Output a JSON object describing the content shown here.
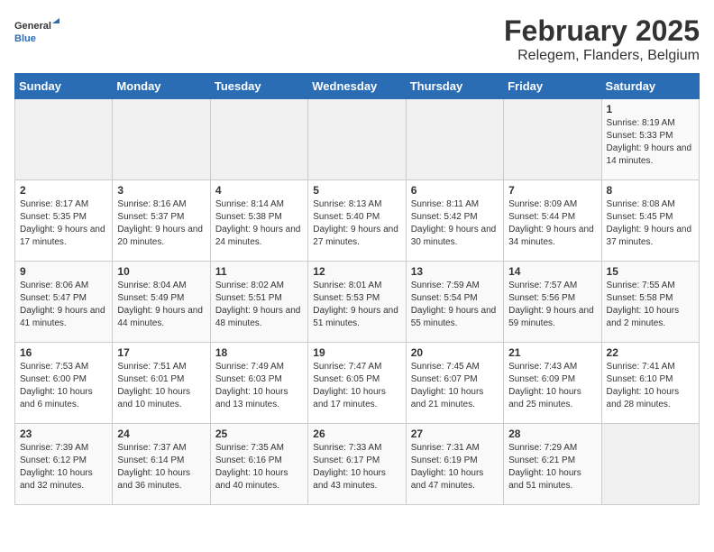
{
  "header": {
    "logo_general": "General",
    "logo_blue": "Blue",
    "main_title": "February 2025",
    "subtitle": "Relegem, Flanders, Belgium"
  },
  "days_of_week": [
    "Sunday",
    "Monday",
    "Tuesday",
    "Wednesday",
    "Thursday",
    "Friday",
    "Saturday"
  ],
  "weeks": [
    [
      {
        "day": "",
        "info": ""
      },
      {
        "day": "",
        "info": ""
      },
      {
        "day": "",
        "info": ""
      },
      {
        "day": "",
        "info": ""
      },
      {
        "day": "",
        "info": ""
      },
      {
        "day": "",
        "info": ""
      },
      {
        "day": "1",
        "info": "Sunrise: 8:19 AM\nSunset: 5:33 PM\nDaylight: 9 hours and 14 minutes."
      }
    ],
    [
      {
        "day": "2",
        "info": "Sunrise: 8:17 AM\nSunset: 5:35 PM\nDaylight: 9 hours and 17 minutes."
      },
      {
        "day": "3",
        "info": "Sunrise: 8:16 AM\nSunset: 5:37 PM\nDaylight: 9 hours and 20 minutes."
      },
      {
        "day": "4",
        "info": "Sunrise: 8:14 AM\nSunset: 5:38 PM\nDaylight: 9 hours and 24 minutes."
      },
      {
        "day": "5",
        "info": "Sunrise: 8:13 AM\nSunset: 5:40 PM\nDaylight: 9 hours and 27 minutes."
      },
      {
        "day": "6",
        "info": "Sunrise: 8:11 AM\nSunset: 5:42 PM\nDaylight: 9 hours and 30 minutes."
      },
      {
        "day": "7",
        "info": "Sunrise: 8:09 AM\nSunset: 5:44 PM\nDaylight: 9 hours and 34 minutes."
      },
      {
        "day": "8",
        "info": "Sunrise: 8:08 AM\nSunset: 5:45 PM\nDaylight: 9 hours and 37 minutes."
      }
    ],
    [
      {
        "day": "9",
        "info": "Sunrise: 8:06 AM\nSunset: 5:47 PM\nDaylight: 9 hours and 41 minutes."
      },
      {
        "day": "10",
        "info": "Sunrise: 8:04 AM\nSunset: 5:49 PM\nDaylight: 9 hours and 44 minutes."
      },
      {
        "day": "11",
        "info": "Sunrise: 8:02 AM\nSunset: 5:51 PM\nDaylight: 9 hours and 48 minutes."
      },
      {
        "day": "12",
        "info": "Sunrise: 8:01 AM\nSunset: 5:53 PM\nDaylight: 9 hours and 51 minutes."
      },
      {
        "day": "13",
        "info": "Sunrise: 7:59 AM\nSunset: 5:54 PM\nDaylight: 9 hours and 55 minutes."
      },
      {
        "day": "14",
        "info": "Sunrise: 7:57 AM\nSunset: 5:56 PM\nDaylight: 9 hours and 59 minutes."
      },
      {
        "day": "15",
        "info": "Sunrise: 7:55 AM\nSunset: 5:58 PM\nDaylight: 10 hours and 2 minutes."
      }
    ],
    [
      {
        "day": "16",
        "info": "Sunrise: 7:53 AM\nSunset: 6:00 PM\nDaylight: 10 hours and 6 minutes."
      },
      {
        "day": "17",
        "info": "Sunrise: 7:51 AM\nSunset: 6:01 PM\nDaylight: 10 hours and 10 minutes."
      },
      {
        "day": "18",
        "info": "Sunrise: 7:49 AM\nSunset: 6:03 PM\nDaylight: 10 hours and 13 minutes."
      },
      {
        "day": "19",
        "info": "Sunrise: 7:47 AM\nSunset: 6:05 PM\nDaylight: 10 hours and 17 minutes."
      },
      {
        "day": "20",
        "info": "Sunrise: 7:45 AM\nSunset: 6:07 PM\nDaylight: 10 hours and 21 minutes."
      },
      {
        "day": "21",
        "info": "Sunrise: 7:43 AM\nSunset: 6:09 PM\nDaylight: 10 hours and 25 minutes."
      },
      {
        "day": "22",
        "info": "Sunrise: 7:41 AM\nSunset: 6:10 PM\nDaylight: 10 hours and 28 minutes."
      }
    ],
    [
      {
        "day": "23",
        "info": "Sunrise: 7:39 AM\nSunset: 6:12 PM\nDaylight: 10 hours and 32 minutes."
      },
      {
        "day": "24",
        "info": "Sunrise: 7:37 AM\nSunset: 6:14 PM\nDaylight: 10 hours and 36 minutes."
      },
      {
        "day": "25",
        "info": "Sunrise: 7:35 AM\nSunset: 6:16 PM\nDaylight: 10 hours and 40 minutes."
      },
      {
        "day": "26",
        "info": "Sunrise: 7:33 AM\nSunset: 6:17 PM\nDaylight: 10 hours and 43 minutes."
      },
      {
        "day": "27",
        "info": "Sunrise: 7:31 AM\nSunset: 6:19 PM\nDaylight: 10 hours and 47 minutes."
      },
      {
        "day": "28",
        "info": "Sunrise: 7:29 AM\nSunset: 6:21 PM\nDaylight: 10 hours and 51 minutes."
      },
      {
        "day": "",
        "info": ""
      }
    ]
  ]
}
